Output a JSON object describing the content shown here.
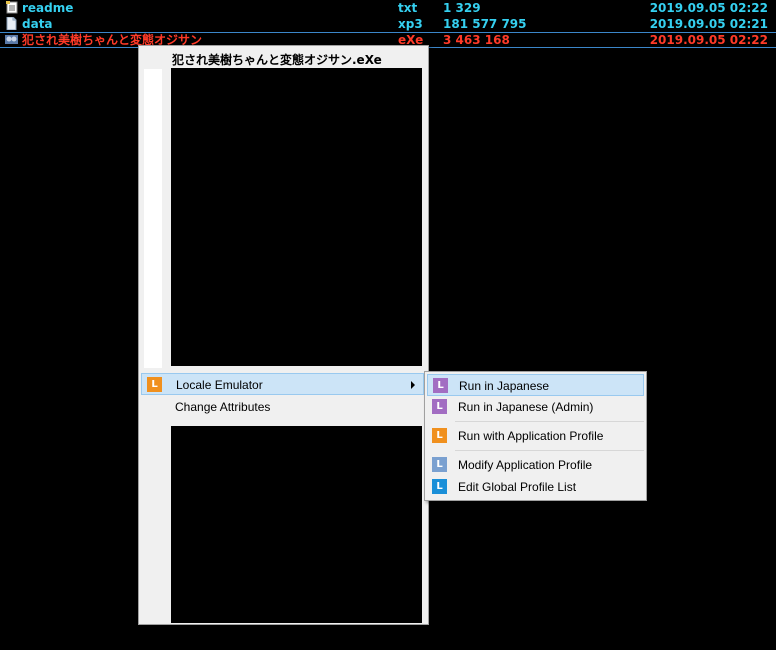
{
  "file_list": {
    "rows": [
      {
        "icon": "text-file-icon",
        "name": "readme",
        "ext": "txt",
        "size": "1 329",
        "date": "2019.09.05 02:22"
      },
      {
        "icon": "file-icon",
        "name": "data",
        "ext": "xp3",
        "size": "181 577 795",
        "date": "2019.09.05 02:21"
      },
      {
        "icon": "exe-icon",
        "name": "犯され美樹ちゃんと変態オジサン",
        "ext": "eXe",
        "size": "3 463 168",
        "date": "2019.09.05 02:22"
      }
    ]
  },
  "context_menu": {
    "preview_title": "犯され美樹ちゃんと変態オジサン.eXe",
    "items": [
      {
        "label": "Locale Emulator",
        "icon": "locale-emulator-icon",
        "icon_letter": "L",
        "icon_color": "#f0901e",
        "has_submenu": true,
        "highlighted": true
      },
      {
        "label": "Change Attributes",
        "has_submenu": false,
        "highlighted": false
      }
    ]
  },
  "submenu": {
    "items": [
      {
        "label": "Run in Japanese",
        "icon": "run-japanese-icon",
        "icon_letter": "L",
        "icon_color": "#a26dc2",
        "highlighted": true
      },
      {
        "label": "Run in Japanese (Admin)",
        "icon": "run-japanese-admin-icon",
        "icon_letter": "L",
        "icon_color": "#a26dc2",
        "highlighted": false
      },
      {
        "label": "Run with Application Profile",
        "icon": "run-profile-icon",
        "icon_letter": "L",
        "icon_color": "#f0901e",
        "highlighted": false
      },
      {
        "label": "Modify Application Profile",
        "icon": "modify-profile-icon",
        "icon_letter": "L",
        "icon_color": "#7aa0d0",
        "highlighted": false
      },
      {
        "label": "Edit Global Profile List",
        "icon": "edit-global-icon",
        "icon_letter": "L",
        "icon_color": "#1a8fd8",
        "highlighted": false
      }
    ]
  },
  "colors": {
    "background": "#000000",
    "file_text": "#35d0f0",
    "selected_text": "#ff3a28",
    "selection_border": "#3b86c9",
    "menu_background": "#f0f0f0",
    "menu_highlight": "#cce4f7"
  }
}
